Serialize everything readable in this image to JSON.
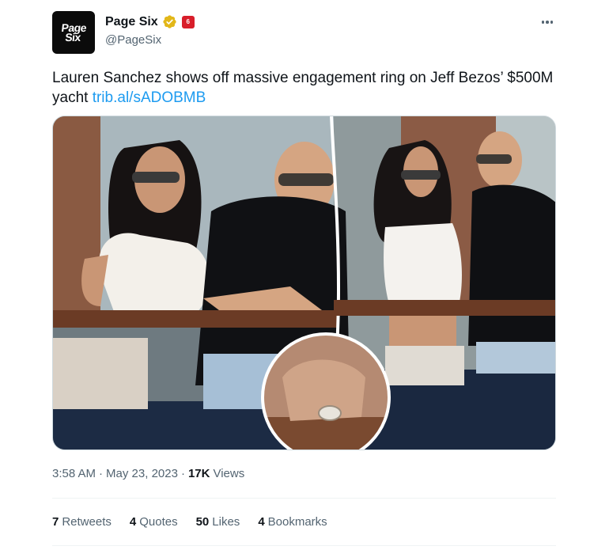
{
  "author": {
    "avatar_text_line1": "Page",
    "avatar_text_line2": "Six",
    "name": "Page Six",
    "handle": "@PageSix",
    "affiliate_badge_text": "6"
  },
  "tweet": {
    "text": "Lauren Sanchez shows off massive engagement ring on Jeff Bezos’ $500M yacht ",
    "link": "trib.al/sADOBMB"
  },
  "meta": {
    "time": "3:58 AM",
    "separator": "·",
    "date": "May 23, 2023",
    "views_count": "17K",
    "views_label": "Views"
  },
  "stats": {
    "retweets_count": "7",
    "retweets_label": "Retweets",
    "quotes_count": "4",
    "quotes_label": "Quotes",
    "likes_count": "50",
    "likes_label": "Likes",
    "bookmarks_count": "4",
    "bookmarks_label": "Bookmarks"
  },
  "colors": {
    "link": "#1d9bf0",
    "verified": "#e2b719",
    "affiliate_badge": "#d81e2a"
  },
  "icons": [
    "verified-badge-icon",
    "affiliate-badge-icon",
    "more-options-icon"
  ]
}
